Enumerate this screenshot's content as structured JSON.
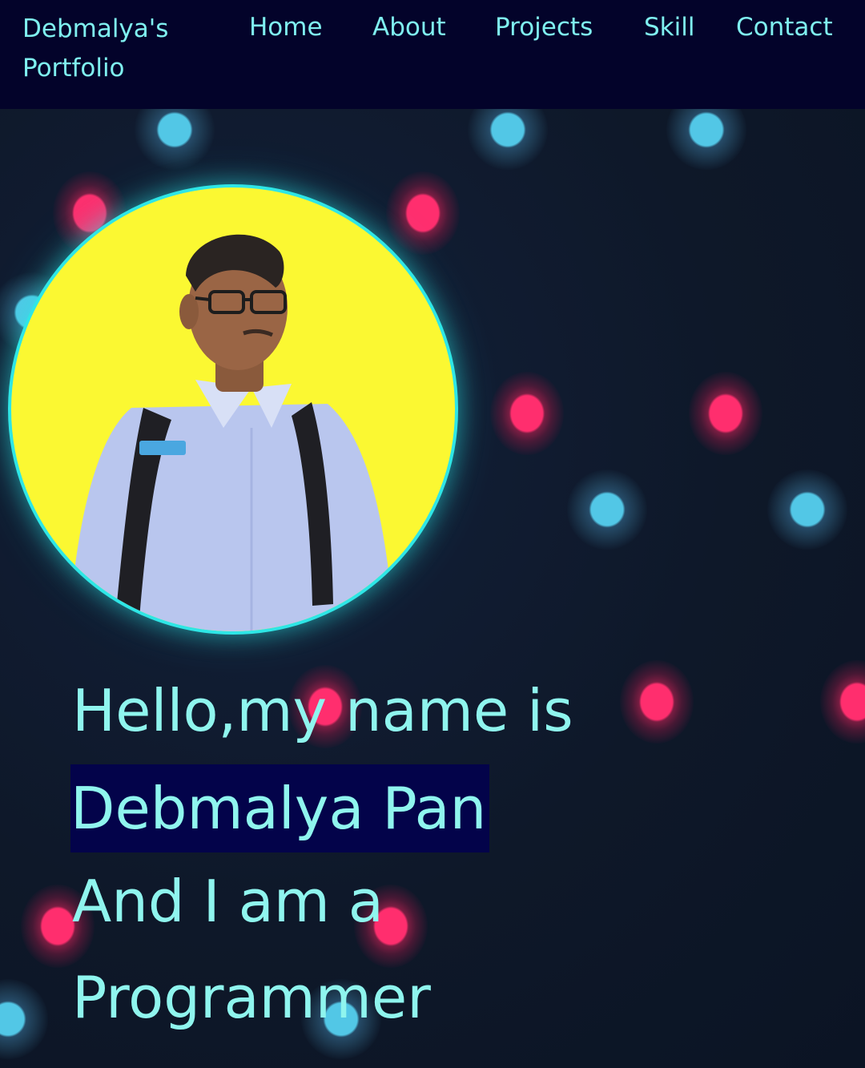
{
  "brand": {
    "title": "Debmalya's Portfolio"
  },
  "nav": {
    "items": [
      {
        "label": "Home"
      },
      {
        "label": "About"
      },
      {
        "label": "Projects"
      },
      {
        "label": "Skill"
      },
      {
        "label": "Contact"
      }
    ]
  },
  "hero": {
    "greeting": "Hello,my name is",
    "name": "Debmalya Pan",
    "role_prefix": "And I am a",
    "role": "Programmer"
  },
  "colors": {
    "navbar_bg": "#03032a",
    "text_accent": "#7ff0f0",
    "hero_text": "#8ff5ee",
    "name_highlight_bg": "#03034a",
    "avatar_bg": "#fbf832",
    "avatar_border": "#2ee6e6",
    "dot_pink": "#ff2e6e",
    "dot_blue": "#52c7e6",
    "page_bg": "#0d1628"
  },
  "icons": {
    "avatar": "profile-photo"
  }
}
